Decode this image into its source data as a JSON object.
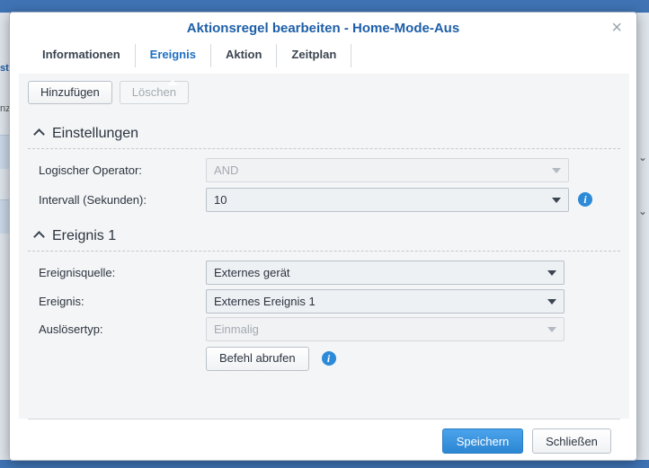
{
  "dialog": {
    "title": "Aktionsregel bearbeiten - Home-Mode-Aus",
    "close_glyph": "×"
  },
  "tabs": [
    {
      "label": "Informationen",
      "active": false
    },
    {
      "label": "Ereignis",
      "active": true
    },
    {
      "label": "Aktion",
      "active": false
    },
    {
      "label": "Zeitplan",
      "active": false
    }
  ],
  "toolbar": {
    "add_label": "Hinzufügen",
    "delete_label": "Löschen"
  },
  "settings": {
    "header": "Einstellungen",
    "operator_label": "Logischer Operator:",
    "operator_value": "AND",
    "interval_label": "Intervall (Sekunden):",
    "interval_value": "10"
  },
  "event1": {
    "header": "Ereignis 1",
    "source_label": "Ereignisquelle:",
    "source_value": "Externes gerät",
    "event_label": "Ereignis:",
    "event_value": "Externes Ereignis 1",
    "trigger_label": "Auslösertyp:",
    "trigger_value": "Einmalig",
    "fetch_command_label": "Befehl abrufen"
  },
  "footer": {
    "save_label": "Speichern",
    "close_label": "Schließen"
  },
  "icons": {
    "info": "i"
  },
  "colors": {
    "accent": "#1f6fc1",
    "primary_button": "#3597e0",
    "info_icon": "#2d8ad8"
  },
  "background": {
    "fragments": [
      "st",
      "nz"
    ]
  }
}
